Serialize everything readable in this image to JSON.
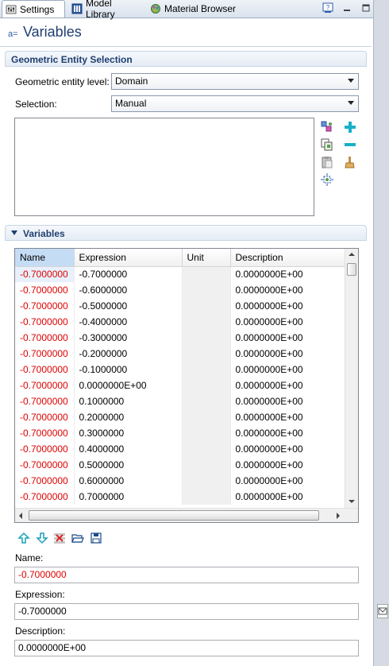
{
  "tabs": [
    {
      "label": "Settings",
      "icon": "settings-icon"
    },
    {
      "label": "Model Library",
      "icon": "model-library-icon"
    },
    {
      "label": "Material Browser",
      "icon": "material-browser-icon"
    }
  ],
  "panel": {
    "prefix": "a=",
    "title": "Variables"
  },
  "geometric": {
    "section_title": "Geometric Entity Selection",
    "level_label": "Geometric entity level:",
    "level_value": "Domain",
    "selection_label": "Selection:",
    "selection_value": "Manual"
  },
  "variables": {
    "section_title": "Variables",
    "columns": [
      "Name",
      "Expression",
      "Unit",
      "Description"
    ],
    "rows": [
      {
        "name": "-0.7000000",
        "expression": "-0.7000000",
        "unit": "",
        "description": "0.0000000E+00"
      },
      {
        "name": "-0.7000000",
        "expression": "-0.6000000",
        "unit": "",
        "description": "0.0000000E+00"
      },
      {
        "name": "-0.7000000",
        "expression": "-0.5000000",
        "unit": "",
        "description": "0.0000000E+00"
      },
      {
        "name": "-0.7000000",
        "expression": "-0.4000000",
        "unit": "",
        "description": "0.0000000E+00"
      },
      {
        "name": "-0.7000000",
        "expression": "-0.3000000",
        "unit": "",
        "description": "0.0000000E+00"
      },
      {
        "name": "-0.7000000",
        "expression": "-0.2000000",
        "unit": "",
        "description": "0.0000000E+00"
      },
      {
        "name": "-0.7000000",
        "expression": "-0.1000000",
        "unit": "",
        "description": "0.0000000E+00"
      },
      {
        "name": "-0.7000000",
        "expression": "0.0000000E+00",
        "unit": "",
        "description": "0.0000000E+00"
      },
      {
        "name": "-0.7000000",
        "expression": "0.1000000",
        "unit": "",
        "description": "0.0000000E+00"
      },
      {
        "name": "-0.7000000",
        "expression": "0.2000000",
        "unit": "",
        "description": "0.0000000E+00"
      },
      {
        "name": "-0.7000000",
        "expression": "0.3000000",
        "unit": "",
        "description": "0.0000000E+00"
      },
      {
        "name": "-0.7000000",
        "expression": "0.4000000",
        "unit": "",
        "description": "0.0000000E+00"
      },
      {
        "name": "-0.7000000",
        "expression": "0.5000000",
        "unit": "",
        "description": "0.0000000E+00"
      },
      {
        "name": "-0.7000000",
        "expression": "0.6000000",
        "unit": "",
        "description": "0.0000000E+00"
      },
      {
        "name": "-0.7000000",
        "expression": "0.7000000",
        "unit": "",
        "description": "0.0000000E+00"
      }
    ]
  },
  "details": {
    "name_label": "Name:",
    "name_value": "-0.7000000",
    "expression_label": "Expression:",
    "expression_value": "-0.7000000",
    "description_label": "Description:",
    "description_value": "0.0000000E+00"
  },
  "colors": {
    "accent": "#1f3e6f",
    "name_text": "#e00000",
    "selection_highlight": "#c5dcf5"
  }
}
